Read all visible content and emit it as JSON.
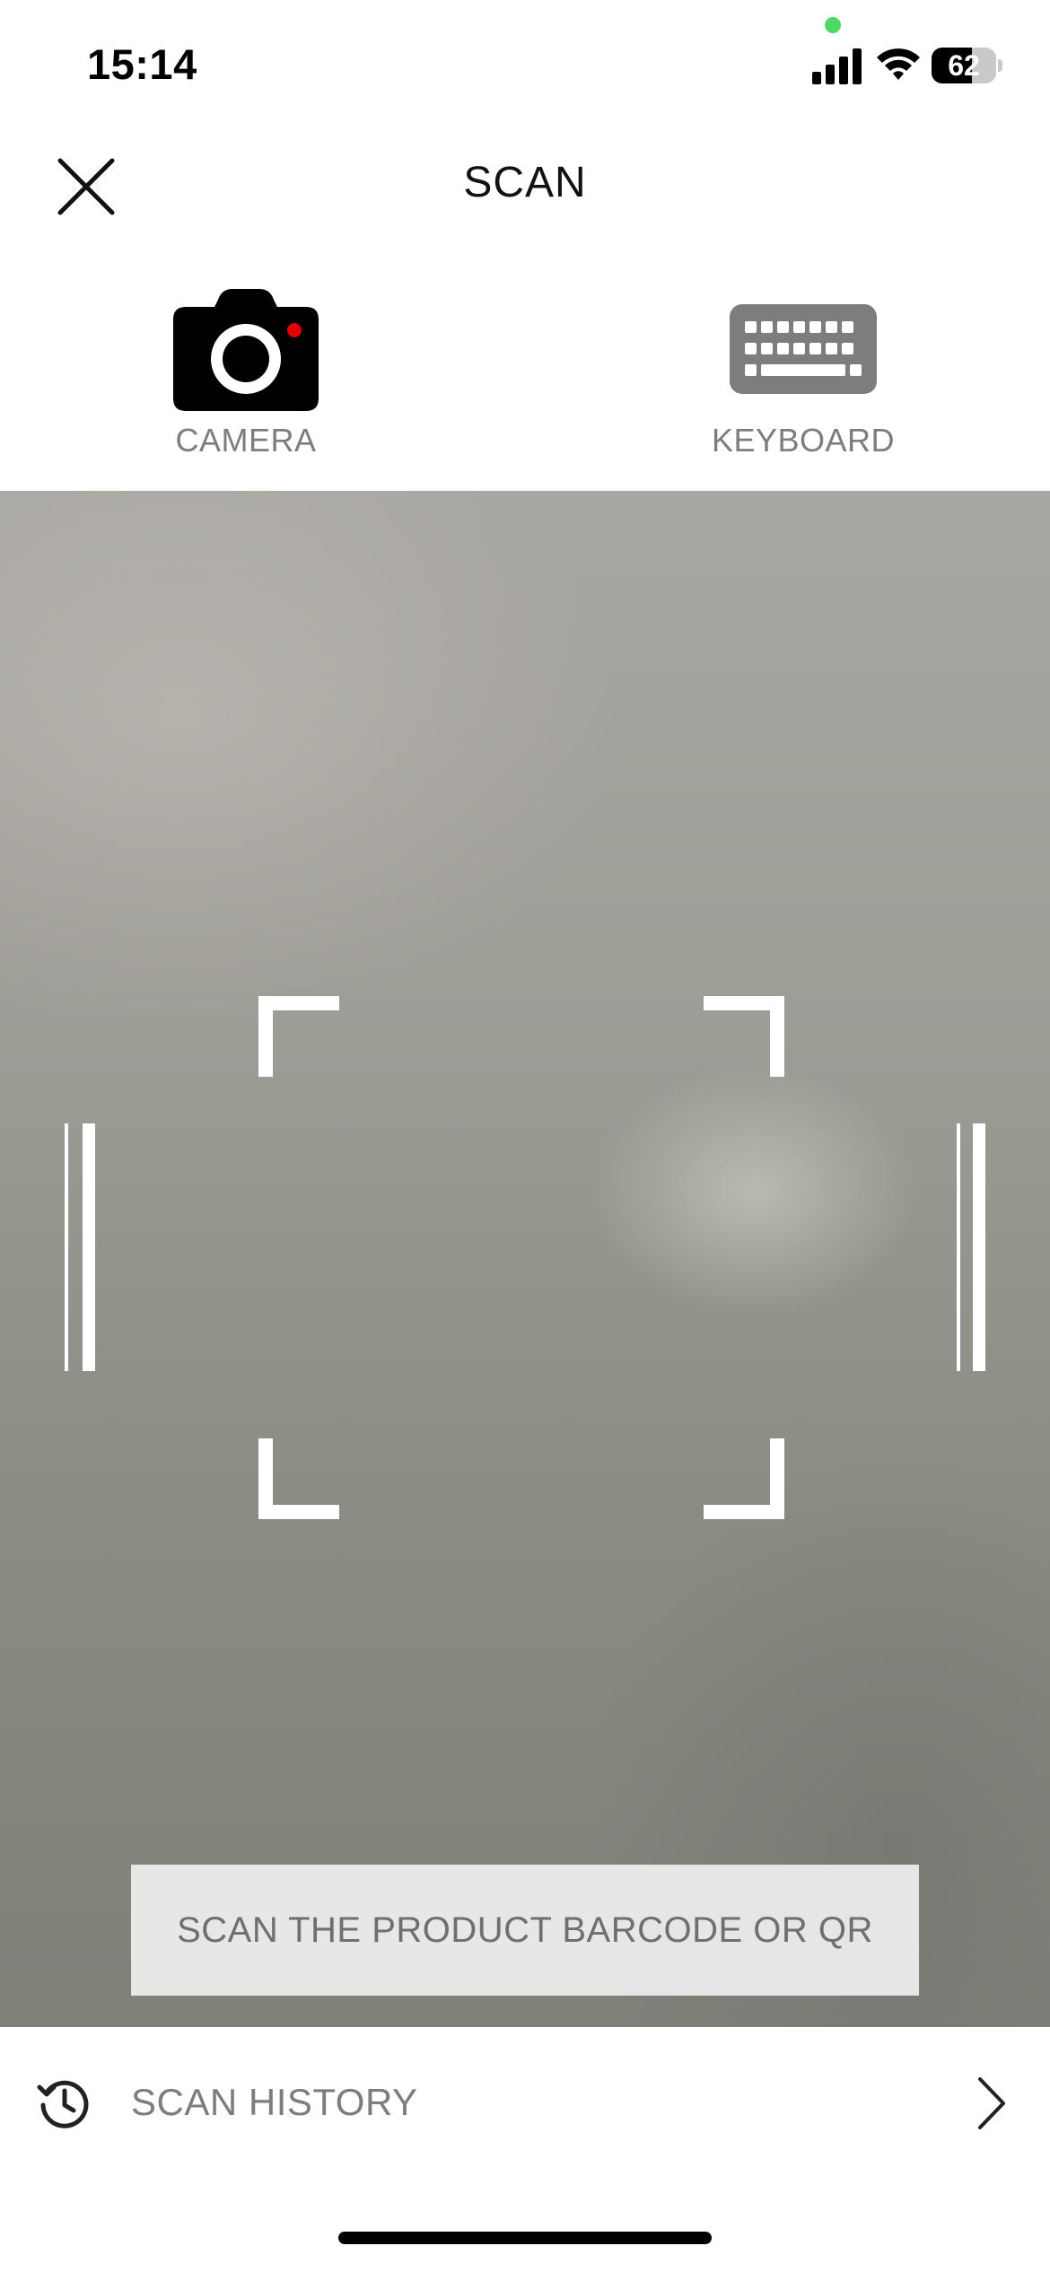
{
  "status_bar": {
    "time": "15:14",
    "battery_level": "62",
    "battery_fraction": 0.62,
    "privacy_indicator_color": "#4cd964"
  },
  "header": {
    "title": "SCAN",
    "close_icon": "close-icon"
  },
  "modes": [
    {
      "label": "CAMERA",
      "icon": "camera-icon",
      "selected": true,
      "icon_color": "#000000",
      "indicator_color": "#e00000"
    },
    {
      "label": "KEYBOARD",
      "icon": "keyboard-icon",
      "selected": false,
      "icon_color": "#7d7d7d"
    }
  ],
  "viewfinder": {
    "instruction": "SCAN THE PRODUCT BARCODE OR QR"
  },
  "history": {
    "label": "SCAN HISTORY",
    "icon": "history-icon",
    "chevron": "chevron-right-icon"
  }
}
